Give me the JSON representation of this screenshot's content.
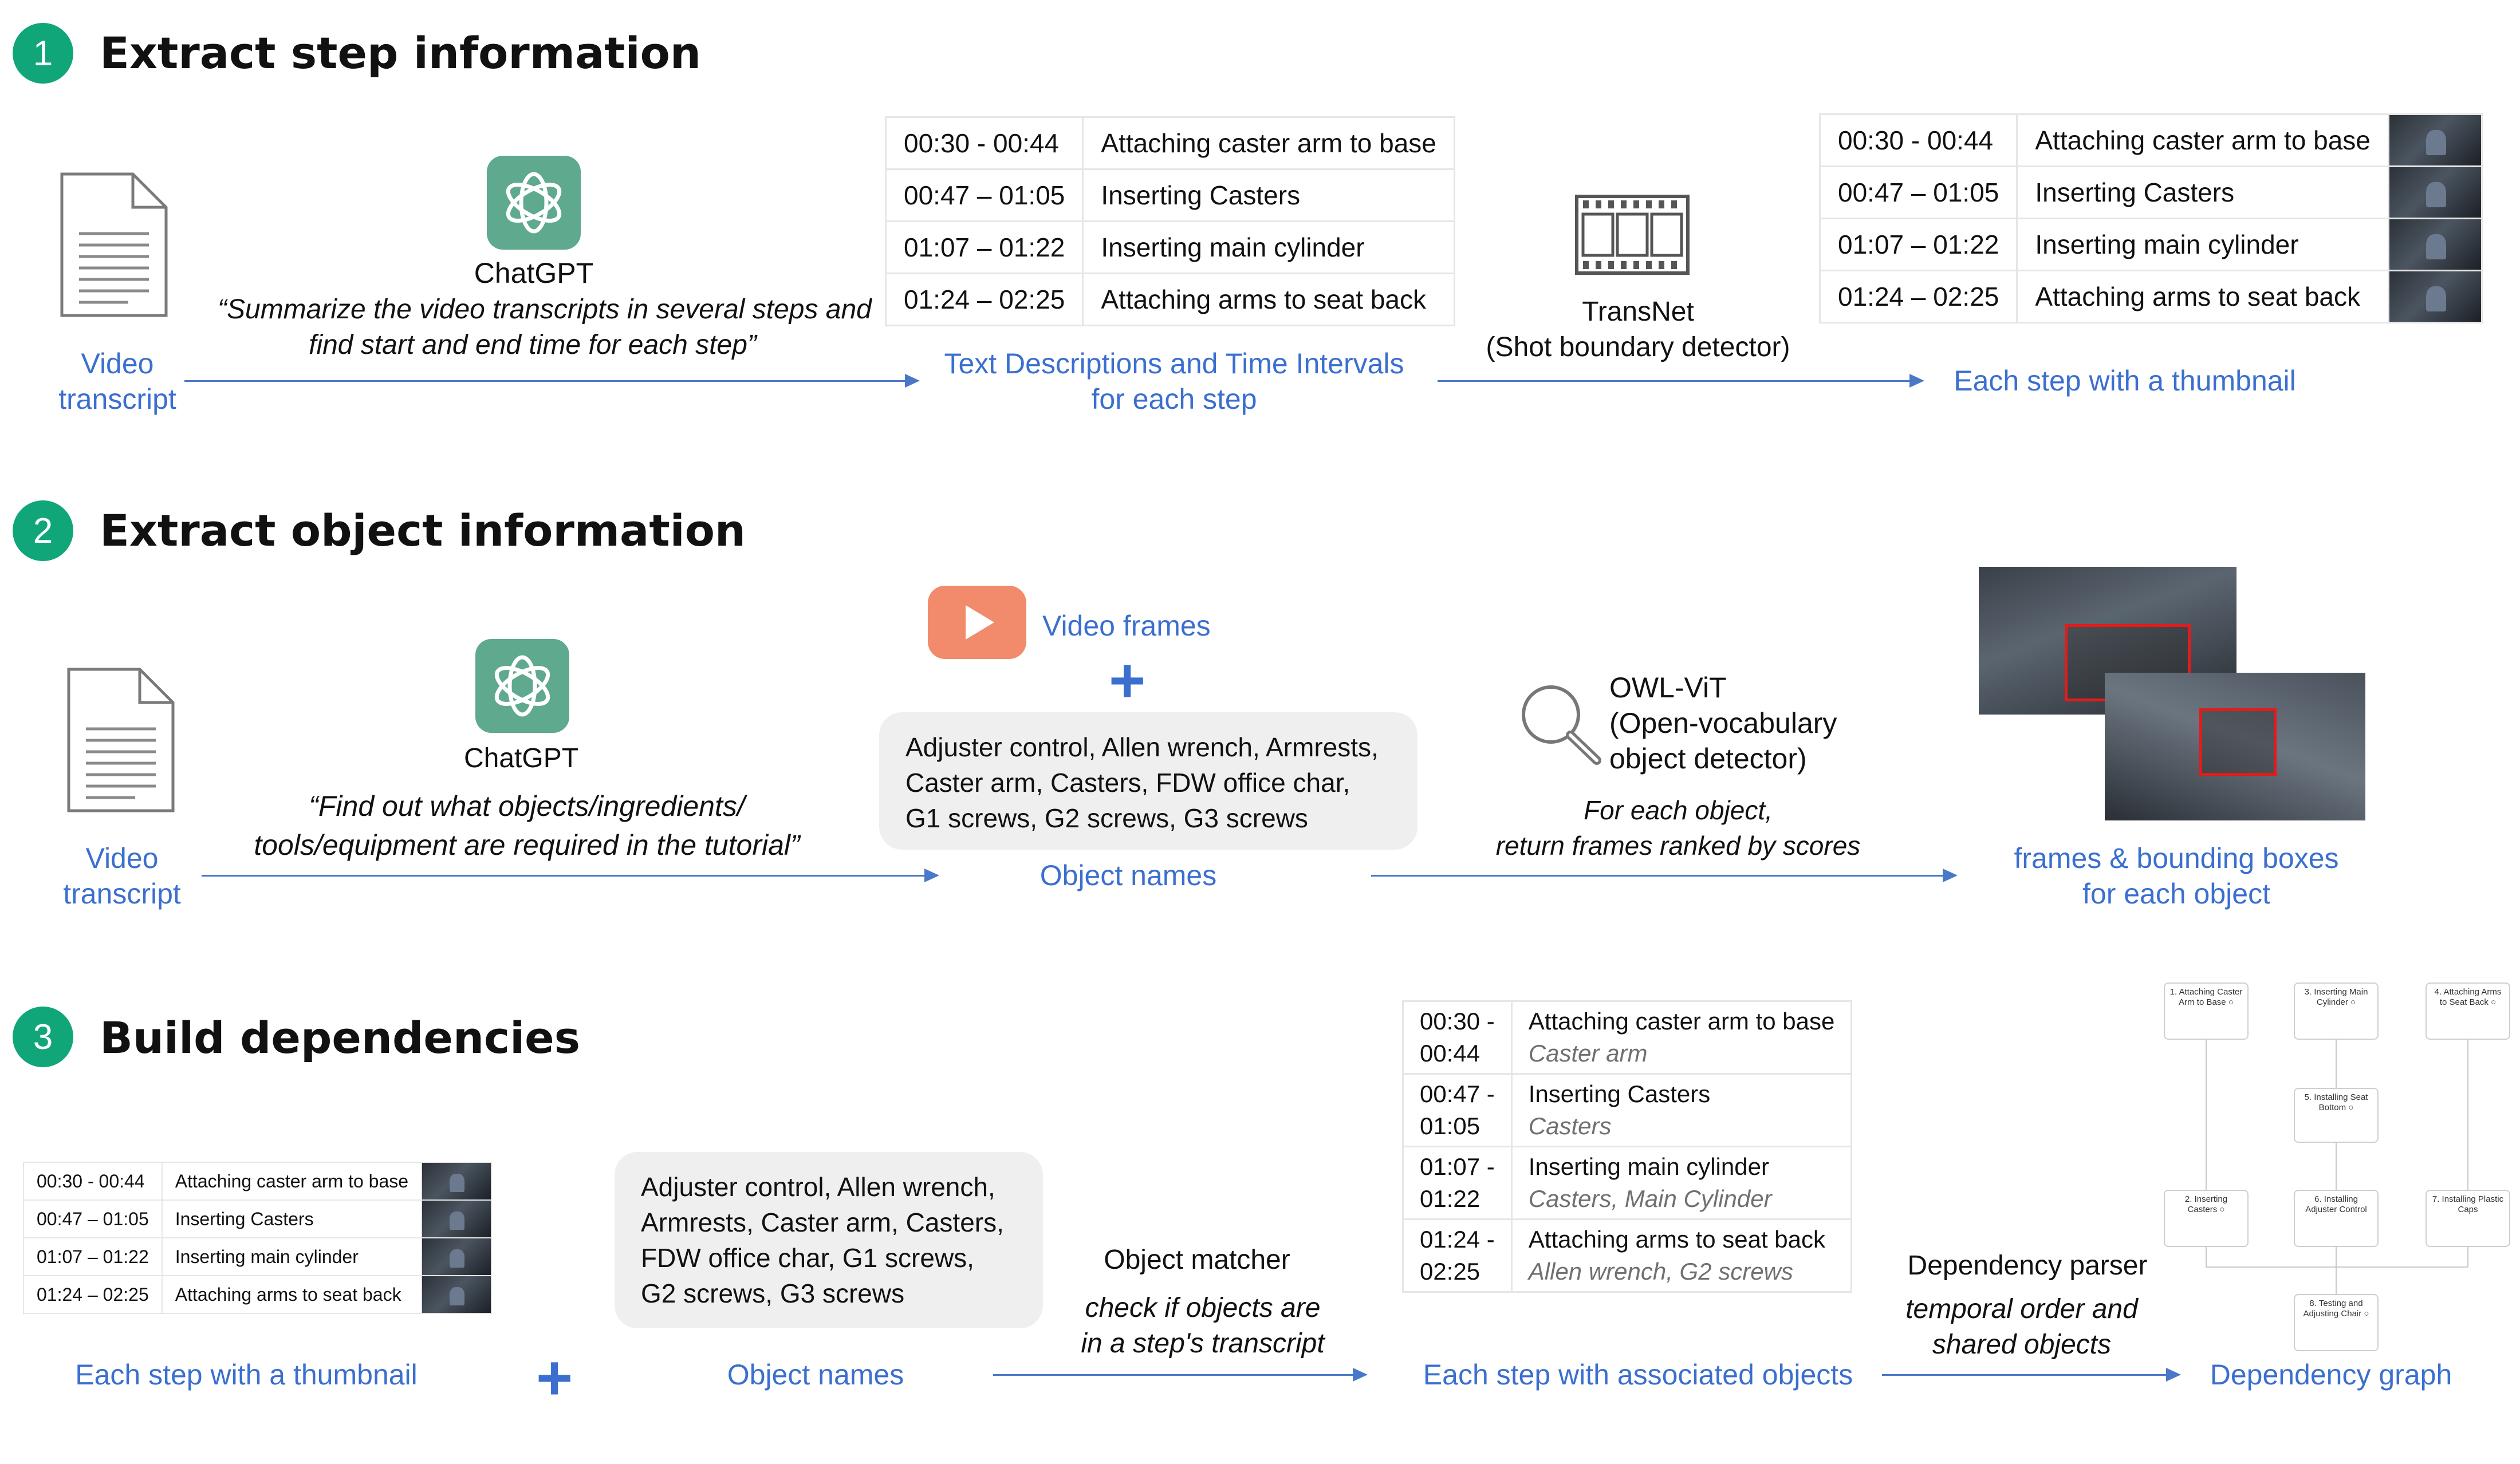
{
  "section1": {
    "number": "1",
    "title": "Extract step information",
    "video_transcript": [
      "Video",
      "transcript"
    ],
    "chatgpt_label": "ChatGPT",
    "prompt": [
      "“Summarize the video transcripts in several steps and",
      "find start and end time for each step”"
    ],
    "text_desc_label": [
      "Text Descriptions and Time Intervals",
      "for each step"
    ],
    "transnet_label": [
      "TransNet",
      "(Shot boundary detector)"
    ],
    "thumbnail_label": "Each step with a thumbnail",
    "steps": [
      {
        "time": "00:30 - 00:44",
        "desc": "Attaching caster arm to base"
      },
      {
        "time": "00:47 – 01:05",
        "desc": "Inserting Casters"
      },
      {
        "time": "01:07 – 01:22",
        "desc": "Inserting main cylinder"
      },
      {
        "time": "01:24 – 02:25",
        "desc": "Attaching arms to seat back"
      }
    ]
  },
  "section2": {
    "number": "2",
    "title": "Extract object information",
    "video_transcript": [
      "Video",
      "transcript"
    ],
    "chatgpt_label": "ChatGPT",
    "prompt": [
      "“Find out what objects/ingredients/",
      "tools/equipment are required in the tutorial”"
    ],
    "video_frames_label": "Video frames",
    "plus": "+",
    "objects": [
      "Adjuster control, Allen wrench, Armrests,",
      "Caster arm, Casters, FDW office char,",
      "G1 screws, G2 screws, G3 screws"
    ],
    "object_names_label": "Object names",
    "owl_label": [
      "OWL-ViT",
      "(Open-vocabulary",
      "object detector)"
    ],
    "owl_desc": [
      "For each object,",
      "return frames ranked by scores"
    ],
    "frames_label": [
      "frames & bounding boxes",
      "for each object"
    ]
  },
  "section3": {
    "number": "3",
    "title": "Build dependencies",
    "steps_small": [
      {
        "time": "00:30 - 00:44",
        "desc": "Attaching caster arm to base"
      },
      {
        "time": "00:47 – 01:05",
        "desc": "Inserting Casters"
      },
      {
        "time": "01:07 – 01:22",
        "desc": "Inserting main cylinder"
      },
      {
        "time": "01:24 – 02:25",
        "desc": "Attaching arms to seat back"
      }
    ],
    "thumbnail_label": "Each step with a thumbnail",
    "plus": "+",
    "objects": [
      "Adjuster control, Allen wrench,",
      "Armrests, Caster arm, Casters,",
      "FDW office char, G1 screws,",
      "G2 screws, G3 screws"
    ],
    "object_names_label": "Object names",
    "matcher_label": "Object matcher",
    "matcher_desc": [
      "check if objects are",
      "in a step's transcript"
    ],
    "assoc": [
      {
        "time": [
          "00:30 -",
          "00:44"
        ],
        "desc": "Attaching caster arm to base",
        "objects": "Caster arm"
      },
      {
        "time": [
          "00:47 -",
          "01:05"
        ],
        "desc": "Inserting Casters",
        "objects": "Casters"
      },
      {
        "time": [
          "01:07 -",
          "01:22"
        ],
        "desc": "Inserting main cylinder",
        "objects": "Casters, Main Cylinder"
      },
      {
        "time": [
          "01:24 -",
          "02:25"
        ],
        "desc": "Attaching arms to seat back",
        "objects": "Allen wrench, G2 screws"
      }
    ],
    "assoc_label": "Each step with associated objects",
    "parser_label": "Dependency parser",
    "parser_desc": [
      "temporal order and",
      "shared objects"
    ],
    "graph_label": "Dependency graph",
    "graph_nodes": [
      [
        "1. Attaching Caster",
        "Arm to Base ○"
      ],
      [
        "3. Inserting Main",
        "Cylinder ○"
      ],
      [
        "4. Attaching Arms",
        "to Seat Back ○"
      ],
      [
        "5. Installing Seat",
        "Bottom ○"
      ],
      [
        "2. Inserting",
        "Casters ○"
      ],
      [
        "6. Installing",
        "Adjuster Control"
      ],
      [
        "7. Installing Plastic",
        "Caps"
      ],
      [
        "8. Testing and",
        "Adjusting Chair ○"
      ]
    ]
  },
  "colors": {
    "accent_green": "#11a67a",
    "label_blue": "#3b6fcf",
    "arrow_blue": "#4a78c8",
    "youtube": "#f28b6b",
    "chatgpt": "#5fa98f"
  }
}
